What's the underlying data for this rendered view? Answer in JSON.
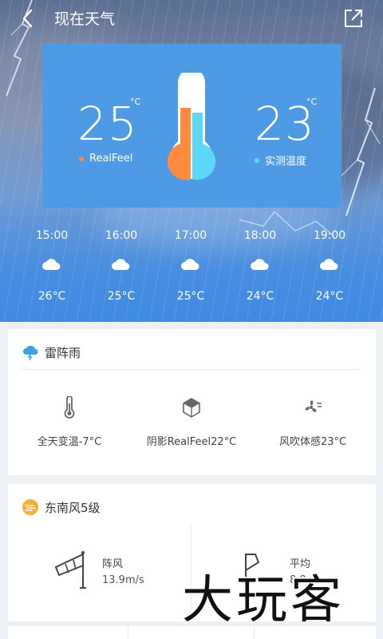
{
  "header": {
    "title": "现在天气",
    "back_icon": "chevron-left-icon",
    "share_icon": "external-share-icon"
  },
  "current": {
    "realfeel_temp": "25",
    "realfeel_unit": "°C",
    "realfeel_label": "RealFeel",
    "actual_temp": "23",
    "actual_unit": "°C",
    "actual_label": "实测温度",
    "colors": {
      "realfeel": "#ff8a3d",
      "actual": "#5ad8f5"
    }
  },
  "hourly": [
    {
      "time": "15:00",
      "temp": "26°C",
      "icon": "cloud-icon"
    },
    {
      "time": "16:00",
      "temp": "25°C",
      "icon": "cloud-icon"
    },
    {
      "time": "17:00",
      "temp": "25°C",
      "icon": "cloud-icon"
    },
    {
      "time": "18:00",
      "temp": "24°C",
      "icon": "cloud-icon"
    },
    {
      "time": "19:00",
      "temp": "24°C",
      "icon": "cloud-icon"
    }
  ],
  "condition_card": {
    "title": "雷阵雨",
    "icon": "thunderstorm-icon",
    "stats": [
      {
        "label": "全天变温-7°C",
        "icon": "thermometer-icon"
      },
      {
        "label": "阴影RealFeel22°C",
        "icon": "shade-box-icon"
      },
      {
        "label": "风吹体感23°C",
        "icon": "fan-icon"
      }
    ]
  },
  "wind_card": {
    "title": "东南风5级",
    "icon": "wind-icon",
    "gust": {
      "label": "阵风",
      "value": "13.9m/s",
      "icon": "windsock-icon"
    },
    "average": {
      "label": "平均",
      "value": "8.8m/s",
      "icon": "flag-icon"
    }
  },
  "watermark": "大玩客"
}
